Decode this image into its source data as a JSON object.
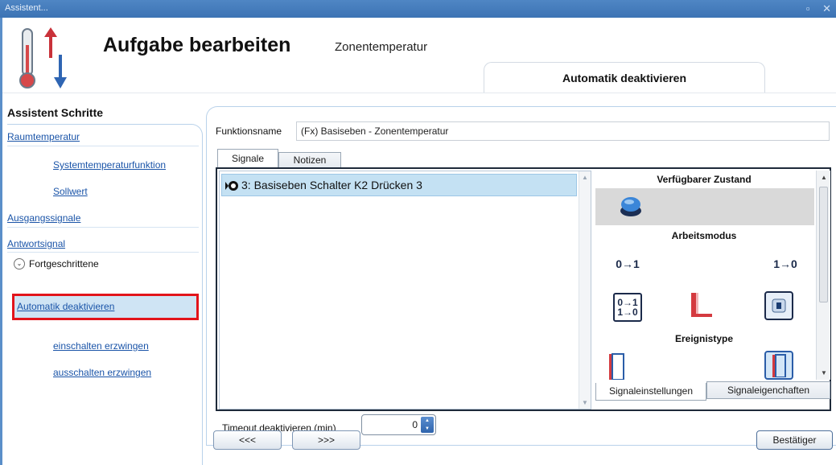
{
  "window": {
    "title": "Assistent...",
    "controls": "▫ ✕"
  },
  "header": {
    "title": "Aufgabe bearbeiten",
    "subtitle": "Zonentemperatur",
    "step_tab": "Automatik deaktivieren"
  },
  "sidebar": {
    "title": "Assistent Schritte",
    "items": [
      {
        "label": "Raumtemperatur"
      },
      {
        "label": "Systemtemperaturfunktion"
      },
      {
        "label": "Sollwert"
      },
      {
        "label": "Ausgangssignale"
      },
      {
        "label": "Antwortsignal"
      },
      {
        "label": "Fortgeschrittene"
      },
      {
        "label": "Automatik deaktivieren"
      },
      {
        "label": "einschalten erzwingen"
      },
      {
        "label": "ausschalten erzwingen"
      }
    ]
  },
  "form": {
    "function_label": "Funktionsname",
    "function_value": "(Fx) Basiseben - Zonentemperatur",
    "tabs": [
      "Signale",
      "Notizen"
    ],
    "signal": "3: Basiseben Schalter K2 Drücken 3",
    "palette": {
      "section1": "Verfügbarer Zustand",
      "section2": "Arbeitsmodus",
      "section3": "Ereignistype",
      "mode_0to1": "0→1",
      "mode_1to0": "1→0",
      "mode_both_top": "0→1",
      "mode_both_bottom": "1→0"
    },
    "bottom_tabs": [
      "Signaleinstellungen",
      "Signaleigenchaften"
    ],
    "timeout_label": "Timeout deaktivieren (min)",
    "timeout_value": "0"
  },
  "buttons": {
    "back": "<<<",
    "next": ">>>",
    "confirm": "Bestätiger"
  },
  "colors": {
    "accent": "#3c73b4",
    "selection": "#c4e1f3",
    "highlight_border": "#e2141b"
  }
}
